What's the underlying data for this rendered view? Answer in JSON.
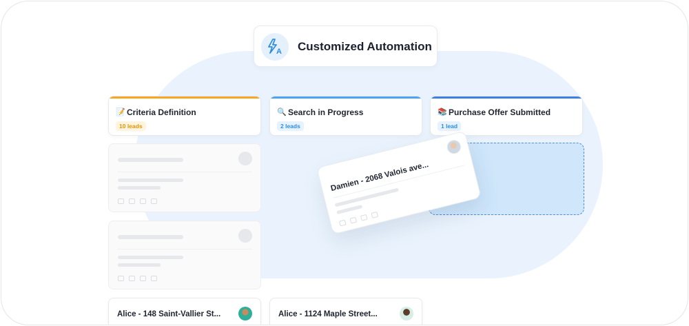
{
  "header": {
    "title": "Customized Automation",
    "icon": "automation-bolt-a-icon"
  },
  "columns": [
    {
      "emoji": "📝",
      "title": "Criteria Definition",
      "badge": "10 leads",
      "accent": "#f5a623",
      "badge_bg": "#fff4de",
      "badge_color": "#e0960c"
    },
    {
      "emoji": "🔍",
      "title": "Search in Progress",
      "badge": "2 leads",
      "accent": "#4aa3f0",
      "badge_bg": "#e6f2fd",
      "badge_color": "#2f8de0"
    },
    {
      "emoji": "📚",
      "title": "Purchase Offer Submitted",
      "badge": "1 lead",
      "accent": "#3d7fe0",
      "badge_bg": "#e6f2fd",
      "badge_color": "#2f8de0"
    }
  ],
  "dragged_card": {
    "name": "Damien - 2068 Valois ave..."
  },
  "lead_cards": [
    {
      "name": "Alice - 148 Saint-Vallier St..."
    },
    {
      "name": "Alice - 1124 Maple Street..."
    }
  ],
  "colors": {
    "blob": "#eaf3fd",
    "dropzone": "#cfe6fb",
    "dropzone_border": "#4a8fd9"
  }
}
